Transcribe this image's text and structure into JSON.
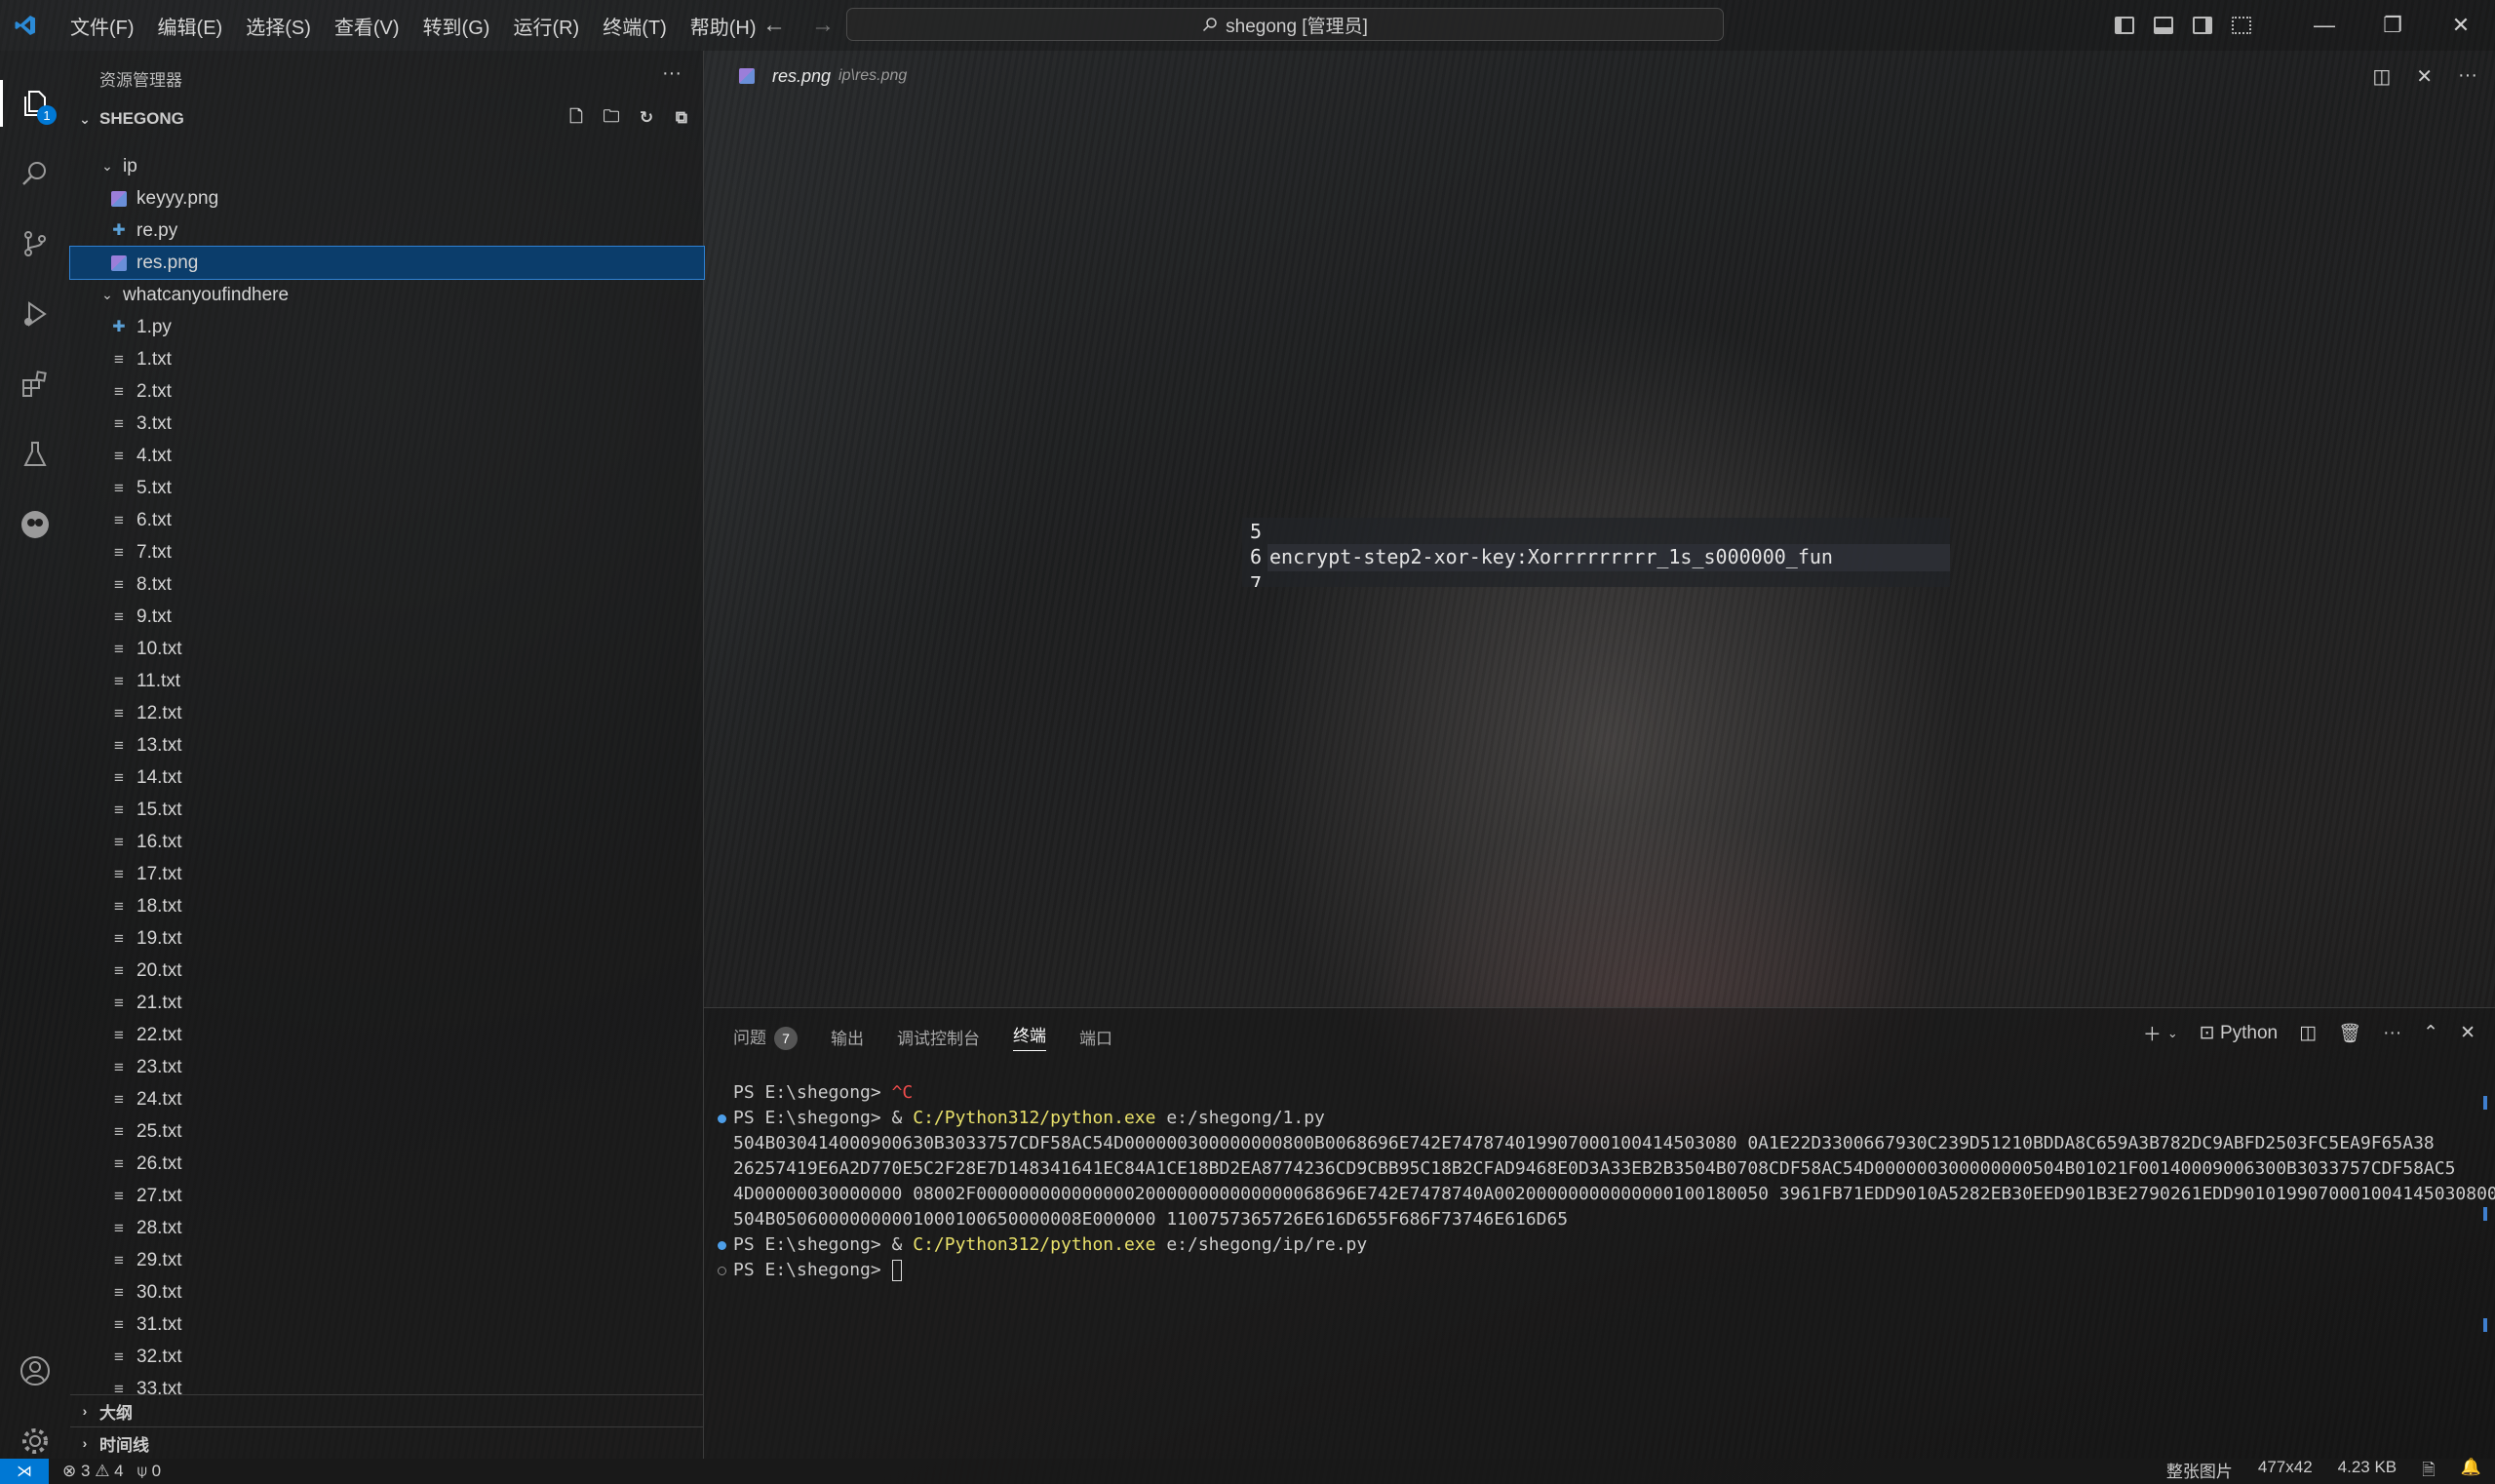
{
  "titlebar": {
    "menu": [
      "文件(F)",
      "编辑(E)",
      "选择(S)",
      "查看(V)",
      "转到(G)",
      "运行(R)",
      "终端(T)",
      "帮助(H)"
    ],
    "search_text": "shegong [管理员]"
  },
  "activitybar": {
    "explorer_badge": "1"
  },
  "sidebar": {
    "title": "资源管理器",
    "folder": "SHEGONG",
    "tree": [
      {
        "label": "ip",
        "type": "folder"
      },
      {
        "label": "keyyy.png",
        "type": "png"
      },
      {
        "label": "re.py",
        "type": "py"
      },
      {
        "label": "res.png",
        "type": "png",
        "selected": true
      },
      {
        "label": "whatcanyoufindhere",
        "type": "folder"
      },
      {
        "label": "1.py",
        "type": "py"
      },
      {
        "label": "1.txt",
        "type": "txt"
      },
      {
        "label": "2.txt",
        "type": "txt"
      },
      {
        "label": "3.txt",
        "type": "txt"
      },
      {
        "label": "4.txt",
        "type": "txt"
      },
      {
        "label": "5.txt",
        "type": "txt"
      },
      {
        "label": "6.txt",
        "type": "txt"
      },
      {
        "label": "7.txt",
        "type": "txt"
      },
      {
        "label": "8.txt",
        "type": "txt"
      },
      {
        "label": "9.txt",
        "type": "txt"
      },
      {
        "label": "10.txt",
        "type": "txt"
      },
      {
        "label": "11.txt",
        "type": "txt"
      },
      {
        "label": "12.txt",
        "type": "txt"
      },
      {
        "label": "13.txt",
        "type": "txt"
      },
      {
        "label": "14.txt",
        "type": "txt"
      },
      {
        "label": "15.txt",
        "type": "txt"
      },
      {
        "label": "16.txt",
        "type": "txt"
      },
      {
        "label": "17.txt",
        "type": "txt"
      },
      {
        "label": "18.txt",
        "type": "txt"
      },
      {
        "label": "19.txt",
        "type": "txt"
      },
      {
        "label": "20.txt",
        "type": "txt"
      },
      {
        "label": "21.txt",
        "type": "txt"
      },
      {
        "label": "22.txt",
        "type": "txt"
      },
      {
        "label": "23.txt",
        "type": "txt"
      },
      {
        "label": "24.txt",
        "type": "txt"
      },
      {
        "label": "25.txt",
        "type": "txt"
      },
      {
        "label": "26.txt",
        "type": "txt"
      },
      {
        "label": "27.txt",
        "type": "txt"
      },
      {
        "label": "28.txt",
        "type": "txt"
      },
      {
        "label": "29.txt",
        "type": "txt"
      },
      {
        "label": "30.txt",
        "type": "txt"
      },
      {
        "label": "31.txt",
        "type": "txt"
      },
      {
        "label": "32.txt",
        "type": "txt"
      },
      {
        "label": "33.txt",
        "type": "txt"
      }
    ],
    "outline_label": "大纲",
    "timeline_label": "时间线"
  },
  "editor": {
    "tab_name": "res.png",
    "tab_path": "ip\\res.png",
    "image_text": {
      "line5": "5",
      "line6": "6",
      "line7": "7",
      "code": "encrypt-step2-xor-key:Xorrrrrrrrr_1s_s000000_fun"
    }
  },
  "panel": {
    "tabs": {
      "problems": "问题",
      "problems_count": "7",
      "output": "输出",
      "debug": "调试控制台",
      "terminal": "终端",
      "ports": "端口"
    },
    "shell": "Python",
    "terminal": {
      "l1_prompt": "PS E:\\shegong> ",
      "l1_cmd": "^C",
      "l2_prompt": "PS E:\\shegong> & ",
      "l2_exe": "C:/Python312/python.exe",
      "l2_arg": " e:/shegong/1.py",
      "out1": "504B030414000900630B3033757CDF58AC54D000000300000000800B0068696E742E747874019907000100414503080 0A1E22D3300667930C239D51210BDDA8C659A3B782DC9ABFD2503FC5EA9F65A38",
      "out2": "26257419E6A2D770E5C2F28E7D148341641EC84A1CE18BD2EA8774236CD9CBB95C18B2CFAD9468E0D3A33EB2B3504B0708CDF58AC54D000000300000000504B01021F00140009006300B3033757CDF58AC5",
      "out3": "4D00000030000000 08002F000000000000000200000000000000068696E742E7478740A00200000000000000100180050 3961FB71EDD9010A5282EB30EED901B3E2790261EDD9010199070001004145030800",
      "out4": "504B05060000000001000100650000008E000000 1100757365726E616D655F686F73746E616D65",
      "l3_prompt": "PS E:\\shegong> & ",
      "l3_exe": "C:/Python312/python.exe",
      "l3_arg": " e:/shegong/ip/re.py",
      "l4_prompt": "PS E:\\shegong> "
    }
  },
  "statusbar": {
    "errors": "3",
    "warnings": "4",
    "ports": "0",
    "image_mode": "整张图片",
    "dimensions": "477x42",
    "size": "4.23 KB"
  },
  "colors": {
    "accent": "#0078d4",
    "selection": "#0b3d6b",
    "terminal_yellow": "#e8e06a"
  }
}
